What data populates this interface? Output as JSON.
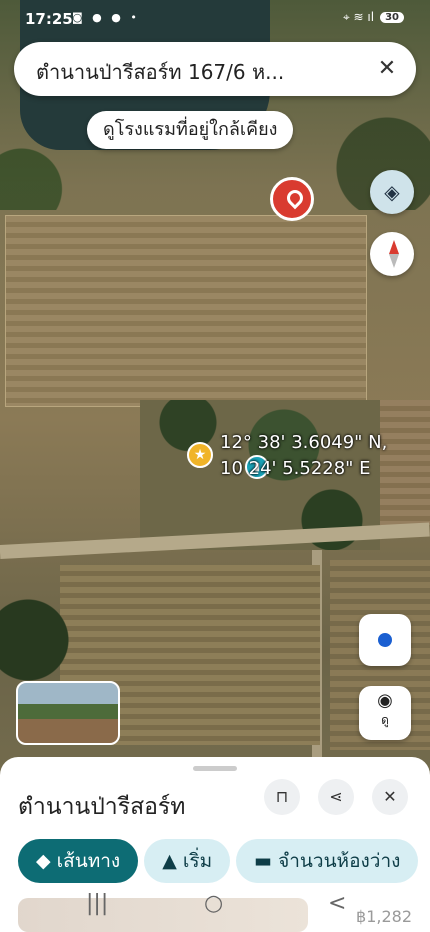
{
  "status_bar": {
    "time": "17:25",
    "left_icons": "◙ ● ● •",
    "right_icons": "⌖ ≋ ıl",
    "battery": "30"
  },
  "search": {
    "query": "ตำนานป่ารีสอร์ท 167/6 ห...",
    "close_icon": "✕"
  },
  "hotels_chip": {
    "label": "ดูโรงแรมที่อยู่ใกล้เคียง"
  },
  "map": {
    "coord_line1": "12° 38' 3.6049\" N,",
    "coord_line2": "10  24' 5.5228\" E",
    "layers_icon": "layers-icon",
    "lens_label": "ดู"
  },
  "sheet": {
    "title": "ตำนานป่ารีสอร์ท",
    "chips": {
      "directions": "เส้นทาง",
      "start": "เริ่ม",
      "rooms": "จำนวนห้องว่าง"
    },
    "price_peek": "฿1,282"
  },
  "nav": {
    "recents": "|||",
    "home": "○",
    "back": "<"
  }
}
